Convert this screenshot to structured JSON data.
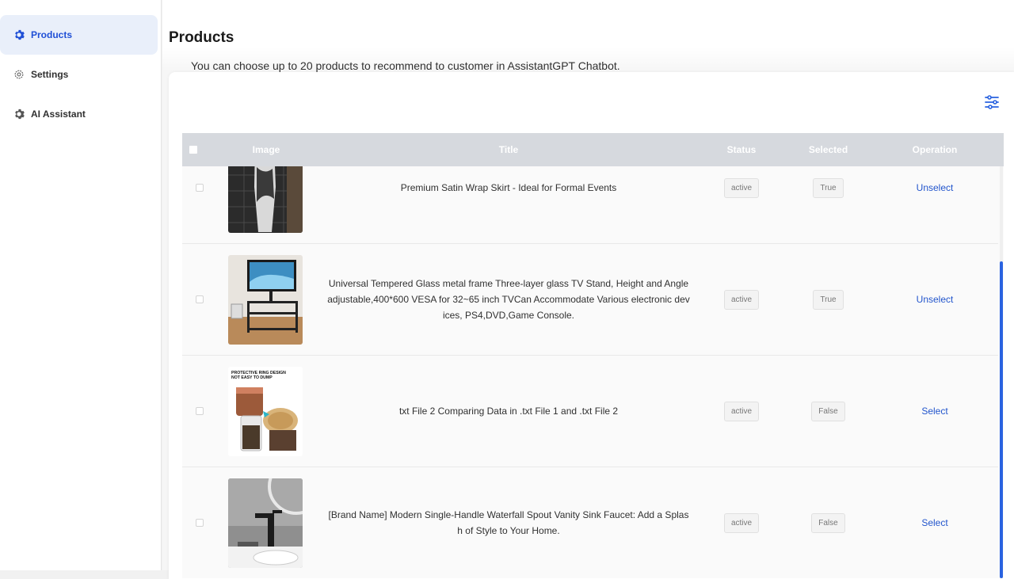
{
  "sidebar": {
    "items": [
      {
        "label": "Products",
        "icon": "gear-icon",
        "active": true
      },
      {
        "label": "Settings",
        "icon": "gear-outline-icon",
        "active": false
      },
      {
        "label": "AI Assistant",
        "icon": "gear-icon",
        "active": false
      }
    ]
  },
  "page": {
    "title": "Products",
    "description": "You can choose up to 20 products to recommend to customer in AssistantGPT Chatbot."
  },
  "toolbar": {
    "settings_icon": "sliders-icon"
  },
  "table": {
    "headers": {
      "image": "Image",
      "title": "Title",
      "status": "Status",
      "selected": "Selected",
      "operation": "Operation"
    },
    "rows": [
      {
        "title": "Premium Satin Wrap Skirt - Ideal for Formal Events",
        "status": "active",
        "selected": "True",
        "operation": "Unselect",
        "image_icon": "skirt-product-image"
      },
      {
        "title": "Universal Tempered Glass metal frame Three-layer glass TV Stand, Height and Angle adjustable,400*600 VESA for 32~65 inch TVCan Accommodate Various electronic devices, PS4,DVD,Game Console.",
        "status": "active",
        "selected": "True",
        "operation": "Unselect",
        "image_icon": "tv-stand-product-image"
      },
      {
        "title": "txt File 2 Comparing Data in .txt File 1 and .txt File 2",
        "status": "active",
        "selected": "False",
        "operation": "Select",
        "image_icon": "jar-product-image",
        "image_caption": "PROTECTIVE RING DESIGN NOT EASY TO DUMP"
      },
      {
        "title": "[Brand Name] Modern Single-Handle Waterfall Spout Vanity Sink Faucet: Add a Splash of Style to Your Home.",
        "status": "active",
        "selected": "False",
        "operation": "Select",
        "image_icon": "faucet-product-image"
      }
    ]
  },
  "colors": {
    "accent": "#2255cc",
    "active_nav_bg": "#e9effa",
    "header_bg": "#d6d9de"
  }
}
